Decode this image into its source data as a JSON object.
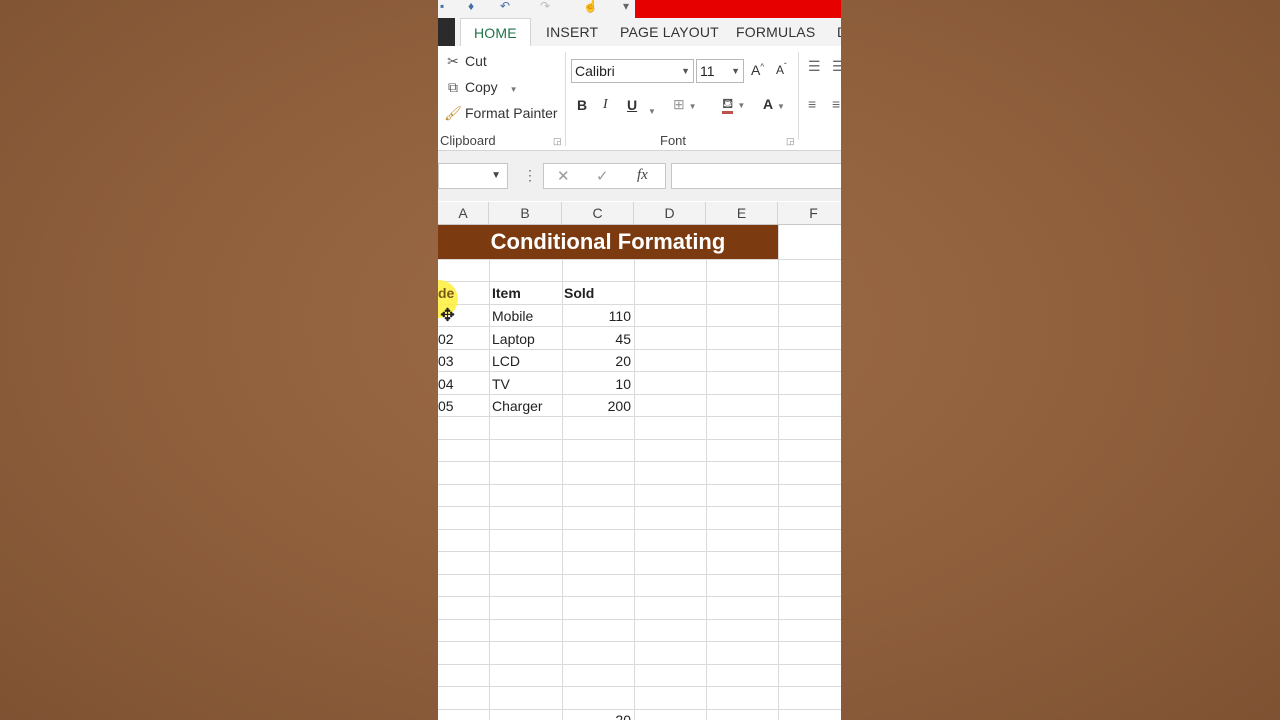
{
  "ribbon": {
    "tabs": [
      "HOME",
      "INSERT",
      "PAGE LAYOUT",
      "FORMULAS",
      "D"
    ],
    "active_tab": "HOME",
    "clipboard": {
      "cut": "Cut",
      "copy": "Copy",
      "format_painter": "Format Painter",
      "group_label": "Clipboard"
    },
    "font": {
      "family": "Calibri",
      "size": "11",
      "bold": "B",
      "italic": "I",
      "underline": "U",
      "font_color": "A",
      "grow": "A",
      "group_label": "Font"
    }
  },
  "formula_bar": {
    "fx": "fx",
    "cancel": "✕",
    "enter": "✓",
    "dots": "⋮"
  },
  "columns": [
    "A",
    "B",
    "C",
    "D",
    "E",
    "F"
  ],
  "sheet": {
    "title": "Conditional Formating",
    "headers": {
      "code": "de",
      "item": "Item",
      "sold": "Sold"
    },
    "rows": [
      {
        "code": "",
        "item": "Mobile",
        "sold": "110"
      },
      {
        "code": "02",
        "item": "Laptop",
        "sold": "45"
      },
      {
        "code": "03",
        "item": "LCD",
        "sold": "20"
      },
      {
        "code": "04",
        "item": "TV",
        "sold": "10"
      },
      {
        "code": "05",
        "item": "Charger",
        "sold": "200"
      }
    ],
    "partial_bottom": "20"
  },
  "colors": {
    "banner": "#7b3a10",
    "active_tab_text": "#217346",
    "red_bar": "#e60000",
    "highlight": "#fff03c"
  }
}
